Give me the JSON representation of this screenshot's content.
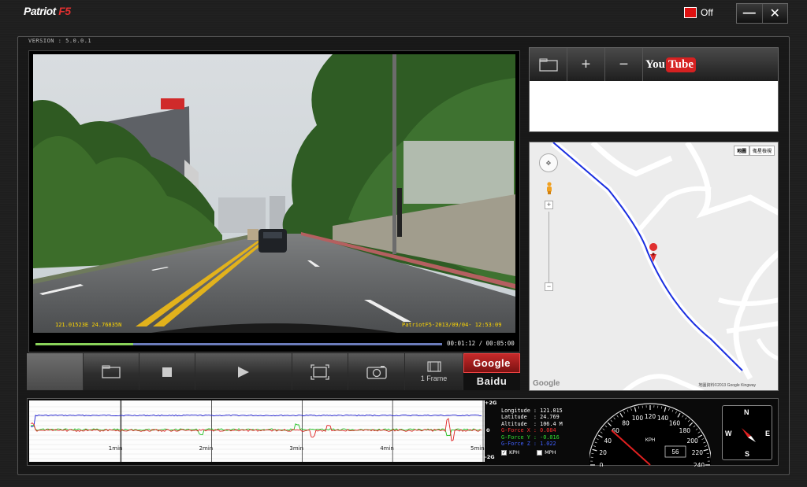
{
  "app": {
    "brand_name": "Patriot",
    "brand_model": "F5",
    "version": "VERSION : 5.0.0.1",
    "record_toggle_label": "Off",
    "minimize_label": "—",
    "close_label": "✕"
  },
  "video": {
    "gps_overlay": "121.01523E 24.76835N",
    "stamp_overlay": "PatriotF5-2013/09/04- 12:53:09",
    "progress_fraction": 0.24,
    "time_readout": "00:01:12 / 00:05:00"
  },
  "controls": {
    "open_icon": "folder-icon",
    "stop_icon": "stop-icon",
    "play_icon": "play-icon",
    "fullscreen_icon": "fullscreen-icon",
    "snapshot_icon": "camera-icon",
    "frame_icon": "film-icon",
    "frame_label": "1 Frame",
    "map_google": "Google",
    "map_baidu": "Baidu"
  },
  "youtube": {
    "add_label": "+",
    "remove_label": "−",
    "logo_you": "You",
    "logo_tube": "Tube"
  },
  "map": {
    "type_map": "地圖",
    "type_satellite": "衛星檢視",
    "attribution": "地圖資料©2013 Google Kingway",
    "logo": "Google"
  },
  "gforce": {
    "axis_top": "+2G",
    "axis_mid": "0",
    "axis_bottom": "-2G",
    "minute_labels": [
      "1min",
      "2min",
      "3min",
      "4min",
      "5min"
    ],
    "colors": {
      "x": "#e02020",
      "y": "#20c020",
      "z": "#2020d0"
    }
  },
  "telemetry": {
    "longitude_label": "Longitude",
    "longitude": "121.015",
    "latitude_label": "Latitude",
    "latitude": "24.769",
    "altitude_label": "Altitude",
    "altitude": "106.4 M",
    "gx_label": "G-Force X",
    "gx": "0.084",
    "gy_label": "G-Force Y",
    "gy": "-0.016",
    "gz_label": "G-Force Z",
    "gz": "1.022",
    "unit_kph": "KPH",
    "unit_mph": "MPH"
  },
  "speedometer": {
    "unit": "KPH",
    "speed": "56",
    "ticks": [
      "0",
      "20",
      "40",
      "60",
      "80",
      "100",
      "120",
      "140",
      "160",
      "180",
      "200",
      "220",
      "240"
    ]
  },
  "compass": {
    "n": "N",
    "e": "E",
    "s": "S",
    "w": "W"
  }
}
